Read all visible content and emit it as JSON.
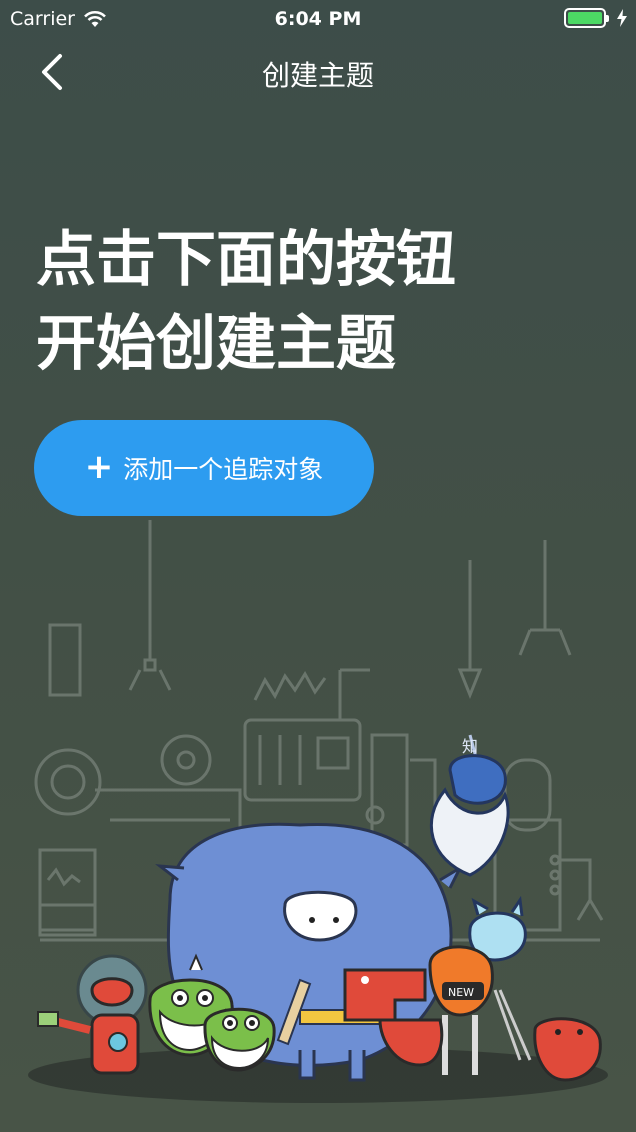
{
  "status_bar": {
    "carrier": "Carrier",
    "time": "6:04 PM",
    "battery_level": 1.0
  },
  "nav": {
    "title": "创建主题",
    "back_icon": "chevron-left-icon"
  },
  "headline": {
    "line1": "点击下面的按钮",
    "line2": "开始创建主题"
  },
  "add_button": {
    "icon": "plus-icon",
    "label": "添加一个追踪对象"
  },
  "illustration": {
    "knowledge_char": "知",
    "badge_text": "NEW"
  },
  "colors": {
    "accent": "#2d9cf0",
    "background": "#3f4e48",
    "monster_blue": "#6e8fd4",
    "monster_red": "#e04a3a",
    "monster_green": "#7bbf4a",
    "monster_orange": "#f07a2a"
  }
}
